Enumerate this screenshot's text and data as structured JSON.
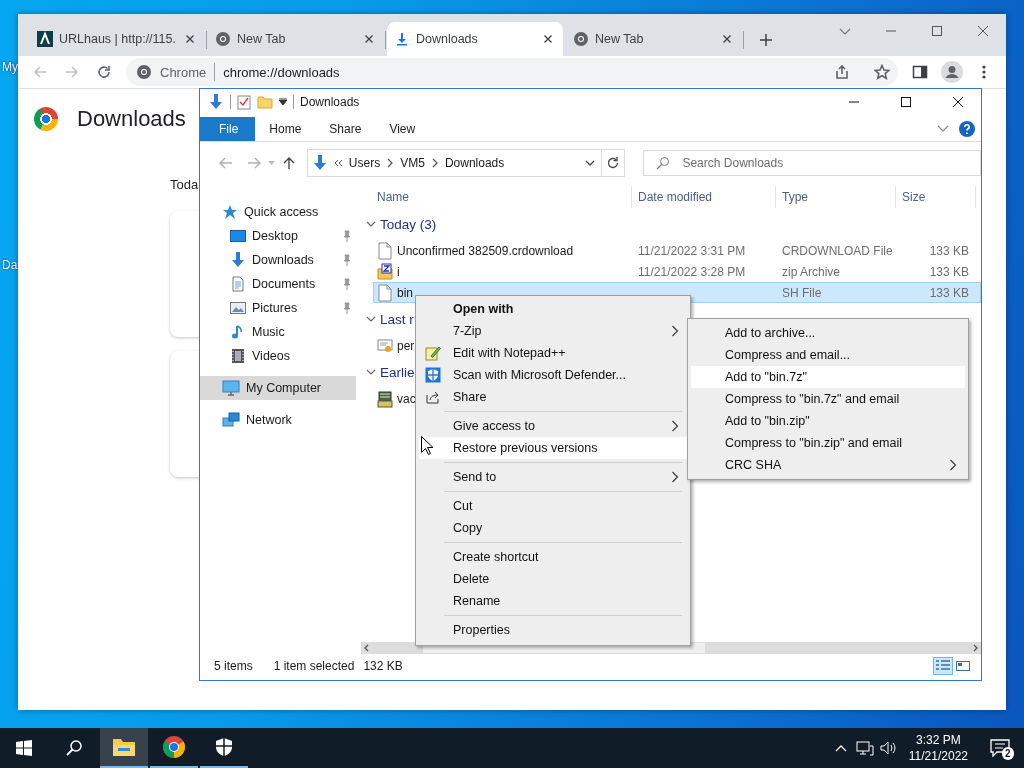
{
  "desktop": {
    "icons": [
      {
        "label": "My"
      },
      {
        "label": "Da"
      }
    ]
  },
  "browser": {
    "tabs": [
      {
        "title": "URLhaus | http://115.",
        "kind": "urlhaus",
        "selected": false
      },
      {
        "title": "New Tab",
        "kind": "newtab",
        "selected": false
      },
      {
        "title": "Downloads",
        "kind": "download",
        "selected": true
      },
      {
        "title": "New Tab",
        "kind": "newtab",
        "selected": false
      }
    ],
    "omnibox": {
      "chip": "Chrome",
      "url": "chrome://downloads"
    },
    "page": {
      "heading": "Downloads",
      "section": "Toda"
    }
  },
  "explorer": {
    "title": "Downloads",
    "ribbon_tabs": [
      {
        "label": "File",
        "kind": "file"
      },
      {
        "label": "Home",
        "kind": "tab"
      },
      {
        "label": "Share",
        "kind": "tab"
      },
      {
        "label": "View",
        "kind": "tab"
      }
    ],
    "breadcrumbs": [
      "Users",
      "VM5",
      "Downloads"
    ],
    "search": {
      "placeholder": "Search Downloads"
    },
    "nav": [
      {
        "label": "Quick access",
        "kind": "star",
        "selected": false,
        "children": [
          {
            "label": "Desktop",
            "kind": "desktop",
            "pinned": true,
            "selected": false
          },
          {
            "label": "Downloads",
            "kind": "download",
            "pinned": true,
            "selected": false
          },
          {
            "label": "Documents",
            "kind": "documents",
            "pinned": true,
            "selected": false
          },
          {
            "label": "Pictures",
            "kind": "pictures",
            "pinned": true,
            "selected": false
          },
          {
            "label": "Music",
            "kind": "music",
            "pinned": false,
            "selected": false
          },
          {
            "label": "Videos",
            "kind": "videos",
            "pinned": false,
            "selected": false
          }
        ]
      },
      {
        "label": "My Computer",
        "kind": "computer",
        "selected": true
      },
      {
        "label": "Network",
        "kind": "network",
        "selected": false
      }
    ],
    "columns": [
      "Name",
      "Date modified",
      "Type",
      "Size"
    ],
    "groups": [
      {
        "label": "Today (3)",
        "rows": [
          {
            "name": "Unconfirmed 382509.crdownload",
            "kind": "file",
            "date": "11/21/2022 3:31 PM",
            "type": "CRDOWNLOAD File",
            "size": "133 KB",
            "selected": false
          },
          {
            "name": "i",
            "kind": "zip",
            "date": "11/21/2022 3:28 PM",
            "type": "zip Archive",
            "size": "133 KB",
            "selected": false
          },
          {
            "name": "bin",
            "kind": "file",
            "type": "SH File",
            "size": "133 KB",
            "selected": true
          }
        ]
      },
      {
        "label": "Last r",
        "rows": [
          {
            "name": "per",
            "kind": "cert",
            "selected": false
          }
        ]
      },
      {
        "label": "Earlie",
        "rows": [
          {
            "name": "vac",
            "kind": "setup",
            "selected": false
          }
        ]
      }
    ],
    "status": {
      "items": "5 items",
      "selection": "1 item selected",
      "size": "132 KB"
    },
    "view_buttons": [
      {
        "kind": "details",
        "selected": true
      },
      {
        "kind": "tiles",
        "selected": false
      }
    ]
  },
  "context_menu": {
    "items": [
      {
        "kind": "item",
        "label": "Open with",
        "default": true,
        "submenu": false,
        "highlighted": false
      },
      {
        "kind": "item",
        "label": "7-Zip",
        "default": false,
        "submenu": true,
        "highlighted": false
      },
      {
        "kind": "notepad",
        "label": "Edit with Notepad++",
        "default": false,
        "submenu": false,
        "highlighted": false
      },
      {
        "kind": "defender",
        "label": "Scan with Microsoft Defender...",
        "default": false,
        "submenu": false,
        "highlighted": false
      },
      {
        "kind": "share",
        "label": "Share",
        "default": false,
        "submenu": false,
        "highlighted": false
      },
      {
        "kind": "separator"
      },
      {
        "kind": "item",
        "label": "Give access to",
        "default": false,
        "submenu": true,
        "highlighted": false
      },
      {
        "kind": "item",
        "label": "Restore previous versions",
        "default": false,
        "submenu": false,
        "highlighted": true
      },
      {
        "kind": "separator"
      },
      {
        "kind": "item",
        "label": "Send to",
        "default": false,
        "submenu": true,
        "highlighted": false
      },
      {
        "kind": "separator"
      },
      {
        "kind": "item",
        "label": "Cut",
        "default": false,
        "submenu": false,
        "highlighted": false
      },
      {
        "kind": "item",
        "label": "Copy",
        "default": false,
        "submenu": false,
        "highlighted": false
      },
      {
        "kind": "separator"
      },
      {
        "kind": "item",
        "label": "Create shortcut",
        "default": false,
        "submenu": false,
        "highlighted": false
      },
      {
        "kind": "item",
        "label": "Delete",
        "default": false,
        "submenu": false,
        "highlighted": false
      },
      {
        "kind": "item",
        "label": "Rename",
        "default": false,
        "submenu": false,
        "highlighted": false
      },
      {
        "kind": "separator"
      },
      {
        "kind": "item",
        "label": "Properties",
        "default": false,
        "submenu": false,
        "highlighted": false
      }
    ]
  },
  "submenu": {
    "items": [
      {
        "kind": "item",
        "label": "Add to archive...",
        "submenu": false,
        "highlighted": false
      },
      {
        "kind": "item",
        "label": "Compress and email...",
        "submenu": false,
        "highlighted": false
      },
      {
        "kind": "item",
        "label": "Add to \"bin.7z\"",
        "submenu": false,
        "highlighted": true
      },
      {
        "kind": "item",
        "label": "Compress to \"bin.7z\" and email",
        "submenu": false,
        "highlighted": false
      },
      {
        "kind": "item",
        "label": "Add to \"bin.zip\"",
        "submenu": false,
        "highlighted": false
      },
      {
        "kind": "item",
        "label": "Compress to \"bin.zip\" and email",
        "submenu": false,
        "highlighted": false
      },
      {
        "kind": "item",
        "label": "CRC SHA",
        "submenu": true,
        "highlighted": false
      }
    ]
  },
  "taskbar": {
    "buttons": [
      {
        "kind": "start",
        "running": false,
        "active": false
      },
      {
        "kind": "search",
        "running": false,
        "active": false
      },
      {
        "kind": "explorer",
        "running": true,
        "active": true
      },
      {
        "kind": "chrome",
        "running": true,
        "active": false
      },
      {
        "kind": "defender",
        "running": true,
        "active": false
      }
    ],
    "time": "3:32 PM",
    "date": "11/21/2022",
    "notifications": "2"
  }
}
